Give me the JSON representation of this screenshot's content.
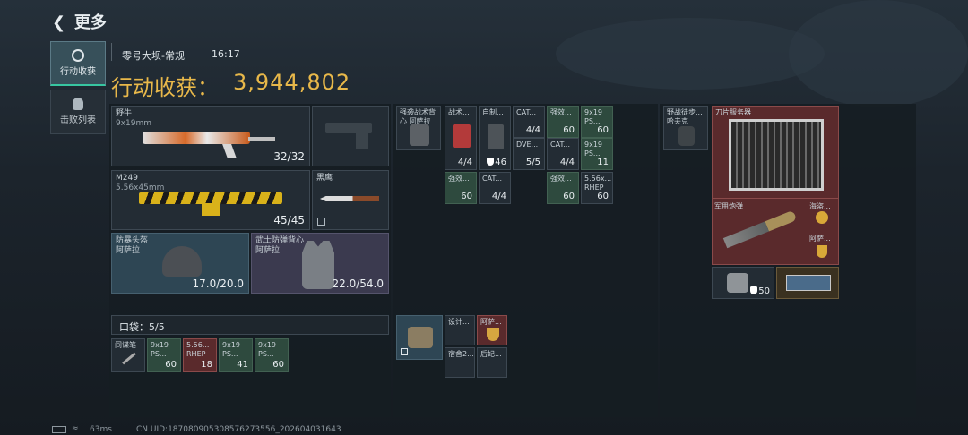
{
  "header": {
    "title": "更多"
  },
  "tabs": [
    {
      "label": "行动收获"
    },
    {
      "label": "击败列表"
    }
  ],
  "match": {
    "map": "零号大坝-常规",
    "time": "16:17"
  },
  "earnings": {
    "label": "行动收获：",
    "value": "3,944,802"
  },
  "equipment": {
    "primary": {
      "name": "野牛",
      "sub": "9x19mm",
      "ammo": "32/32"
    },
    "pistol": {
      "name": ""
    },
    "secondary": {
      "name": "M249",
      "sub": "5.56x45mm",
      "ammo": "45/45"
    },
    "melee": {
      "name": "黑鹰"
    },
    "helmet": {
      "name": "防暴头盔",
      "sub": "阿萨拉",
      "dur": "17.0/20.0"
    },
    "armor": {
      "name": "武士防弹背心",
      "sub": "阿萨拉",
      "dur": "22.0/54.0"
    }
  },
  "pocket": {
    "label": "口袋：5/5",
    "items": [
      {
        "name": "间谍笔",
        "qty": ""
      },
      {
        "name": "9x19 PS...",
        "qty": "60"
      },
      {
        "name": "5.56... RHEP",
        "qty": "18"
      },
      {
        "name": "9x19 PS...",
        "qty": "41"
      },
      {
        "name": "9x19 PS...",
        "qty": "60"
      }
    ]
  },
  "chest_rig": {
    "name": "强袭战术背心 阿萨拉"
  },
  "rig_items": [
    {
      "name": "战术...",
      "qty": "4/4"
    },
    {
      "name": "自制...",
      "qty": "46"
    },
    {
      "name": "CAT...",
      "qty": "4/4"
    },
    {
      "name": "强效...",
      "qty": "60"
    },
    {
      "name": "9x19 PS...",
      "qty": "60"
    },
    {
      "name": "DVE...",
      "qty": "5/5"
    },
    {
      "name": "CAT...",
      "qty": "4/4"
    },
    {
      "name": "9x19 PS...",
      "qty": "11"
    },
    {
      "name": "强效...",
      "qty": "60"
    },
    {
      "name": "CAT...",
      "qty": "4/4"
    },
    {
      "name": "强效...",
      "qty": "60"
    },
    {
      "name": "5.56x... RHEP",
      "qty": "60"
    }
  ],
  "pouch_items": [
    {
      "name": "设计..."
    },
    {
      "name": "阿萨..."
    },
    {
      "name": "宿舍2..."
    },
    {
      "name": "后妃..."
    }
  ],
  "backpack": {
    "name": "野战徒步... 哈夫克"
  },
  "loot": [
    {
      "name": "刀片服务器"
    },
    {
      "name": "军用炮弹"
    },
    {
      "name": "海盗..."
    },
    {
      "name": "阿萨..."
    },
    {
      "name": "",
      "qty": "50"
    },
    {
      "name": ""
    }
  ],
  "status": {
    "ping": "63ms",
    "uid": "CN UID:18708090530857627355​6_202604031643"
  },
  "colors": {
    "accent": "#e8b84a",
    "bg": "#1b2229"
  }
}
